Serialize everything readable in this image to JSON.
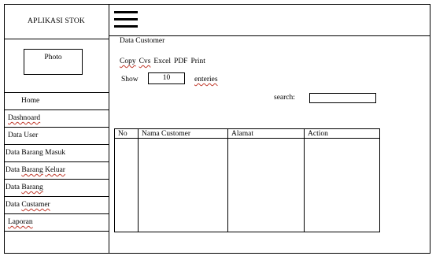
{
  "app_title": "APLIKASI STOK",
  "photo_label": "Photo",
  "menu": [
    {
      "label": "Home"
    },
    {
      "label": "Dashnoard"
    },
    {
      "label": "Data User"
    },
    {
      "label": "Data Barang Masuk"
    },
    {
      "label": "Data Barang Keluar"
    },
    {
      "label": "Data Barang"
    },
    {
      "label": "Data Custamer"
    },
    {
      "label": "Laporan"
    }
  ],
  "content": {
    "title": "Data Customer",
    "export_buttons": [
      "Copy",
      "Cvs",
      "Excel",
      "PDF",
      "Print"
    ],
    "show_label": "Show",
    "show_value": "10",
    "entries_label": "enteries",
    "search_label": "search:",
    "search_value": ""
  },
  "table": {
    "columns": [
      "No",
      "Nama Customer",
      "Alamat",
      "Action"
    ]
  }
}
